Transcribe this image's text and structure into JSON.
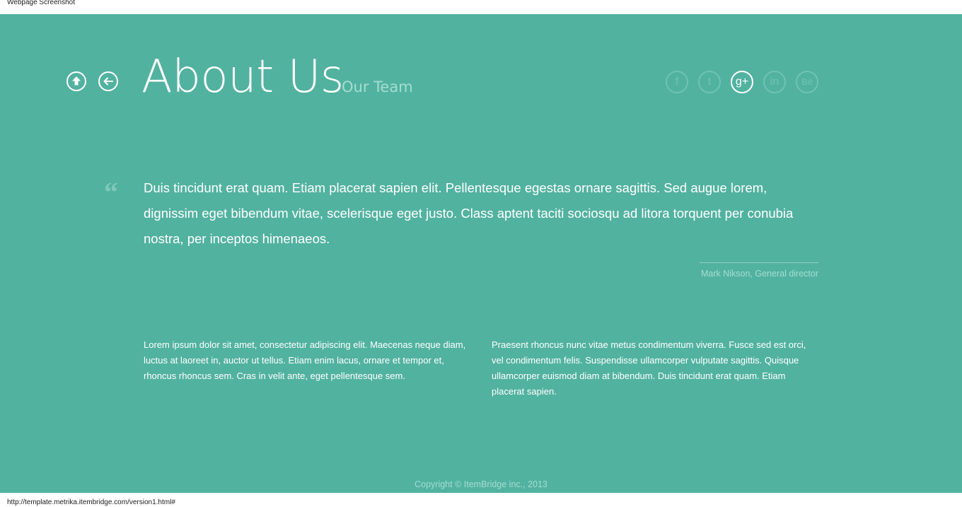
{
  "window": {
    "caption": "Webpage Screenshot",
    "status_url": "http://template.metrika.itembridge.com/version1.html#"
  },
  "colors": {
    "background": "#52b2a0",
    "text": "#ffffff",
    "muted": "#a5ddd1",
    "icon_muted": "#6ec3b2"
  },
  "nav": {
    "up_icon": "arrow-up-circle-icon",
    "back_icon": "arrow-left-circle-icon"
  },
  "header": {
    "title": "About Us",
    "subtitle": "Our Team"
  },
  "social": [
    {
      "name": "facebook",
      "glyph": "f",
      "active": false
    },
    {
      "name": "twitter",
      "glyph": "t",
      "active": false
    },
    {
      "name": "google-plus",
      "glyph": "g+",
      "active": true
    },
    {
      "name": "linkedin",
      "glyph": "in",
      "active": false
    },
    {
      "name": "behance",
      "glyph": "Bē",
      "active": false
    }
  ],
  "quote": {
    "mark": "“",
    "text": "Duis tincidunt erat quam. Etiam placerat sapien elit. Pellentesque egestas ornare sagittis. Sed augue lorem, dignissim eget bibendum vitae, scelerisque eget justo. Class aptent taciti sociosqu ad litora torquent per conubia nostra, per inceptos himenaeos.",
    "author": "Mark Nikson, General director"
  },
  "columns": {
    "left": "Lorem ipsum dolor sit amet, consectetur adipiscing elit. Maecenas neque diam, luctus at laoreet in, auctor ut tellus. Etiam enim lacus, ornare et tempor et, rhoncus rhoncus sem. Cras in velit ante, eget pellentesque sem.",
    "right": "Praesent rhoncus nunc vitae metus condimentum viverra. Fusce sed est orci, vel condimentum felis. Suspendisse ullamcorper vulputate sagittis. Quisque ullamcorper euismod diam at bibendum. Duis tincidunt erat quam. Etiam placerat sapien."
  },
  "footer": {
    "copyright": "Copyright © ItemBridge inc., 2013"
  }
}
